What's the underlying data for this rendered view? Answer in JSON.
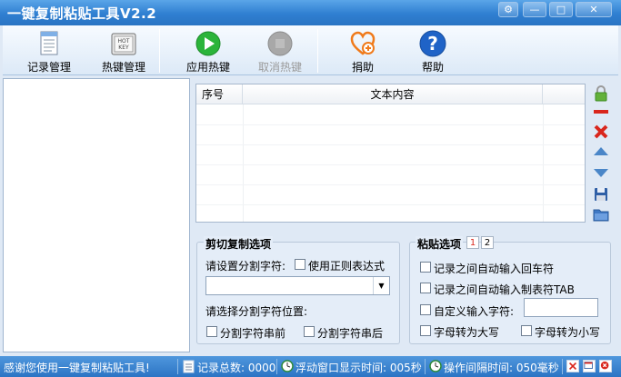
{
  "window": {
    "title": "一键复制粘贴工具V2.2",
    "buttons": [
      "settings-icon",
      "minimize-icon",
      "maximize-icon",
      "close-icon"
    ]
  },
  "toolbar": {
    "items": [
      {
        "label": "记录管理",
        "icon": "document-list-icon",
        "enabled": true
      },
      {
        "label": "热键管理",
        "icon": "hotkey-keyboard-icon",
        "enabled": true
      },
      {
        "label": "应用热键",
        "icon": "play-icon",
        "enabled": true
      },
      {
        "label": "取消热键",
        "icon": "stop-icon",
        "enabled": false
      },
      {
        "label": "捐助",
        "icon": "heart-donate-icon",
        "enabled": true
      },
      {
        "label": "帮助",
        "icon": "help-icon",
        "enabled": true
      }
    ]
  },
  "list": {
    "columns": [
      "序号",
      "文本内容"
    ],
    "rows": []
  },
  "side_tools": [
    "lock-icon",
    "remove-icon",
    "delete-icon",
    "move-up-icon",
    "move-down-icon",
    "save-icon",
    "open-folder-icon"
  ],
  "cut_copy_options": {
    "title": "剪切复制选项",
    "separator_label": "请设置分割字符:",
    "regex_label": "使用正则表达式",
    "separator_value": "",
    "position_label": "请选择分割字符位置:",
    "before_label": "分割字符串前",
    "after_label": "分割字符串后"
  },
  "paste_options": {
    "title": "粘贴选项",
    "tabs": [
      "1",
      "2"
    ],
    "active_tab": "1",
    "enter_label": "记录之间自动输入回车符",
    "tab_label": "记录之间自动输入制表符TAB",
    "custom_label": "自定义输入字符:",
    "custom_value": "",
    "upper_label": "字母转为大写",
    "lower_label": "字母转为小写"
  },
  "status": {
    "message": "感谢您使用一键复制粘贴工具!",
    "record_total": "记录总数: 0000",
    "float_time": "浮动窗口显示时间: 005秒",
    "op_interval": "操作间隔时间: 050毫秒"
  },
  "colors": {
    "title_bar": "#2f7fd1",
    "status_bar": "#2c74c4",
    "window_bg": "#dfe9f5",
    "play_green": "#2bb43a",
    "donate_orange": "#f07a1a",
    "help_blue": "#1f63c7",
    "delete_red": "#d9261c"
  }
}
